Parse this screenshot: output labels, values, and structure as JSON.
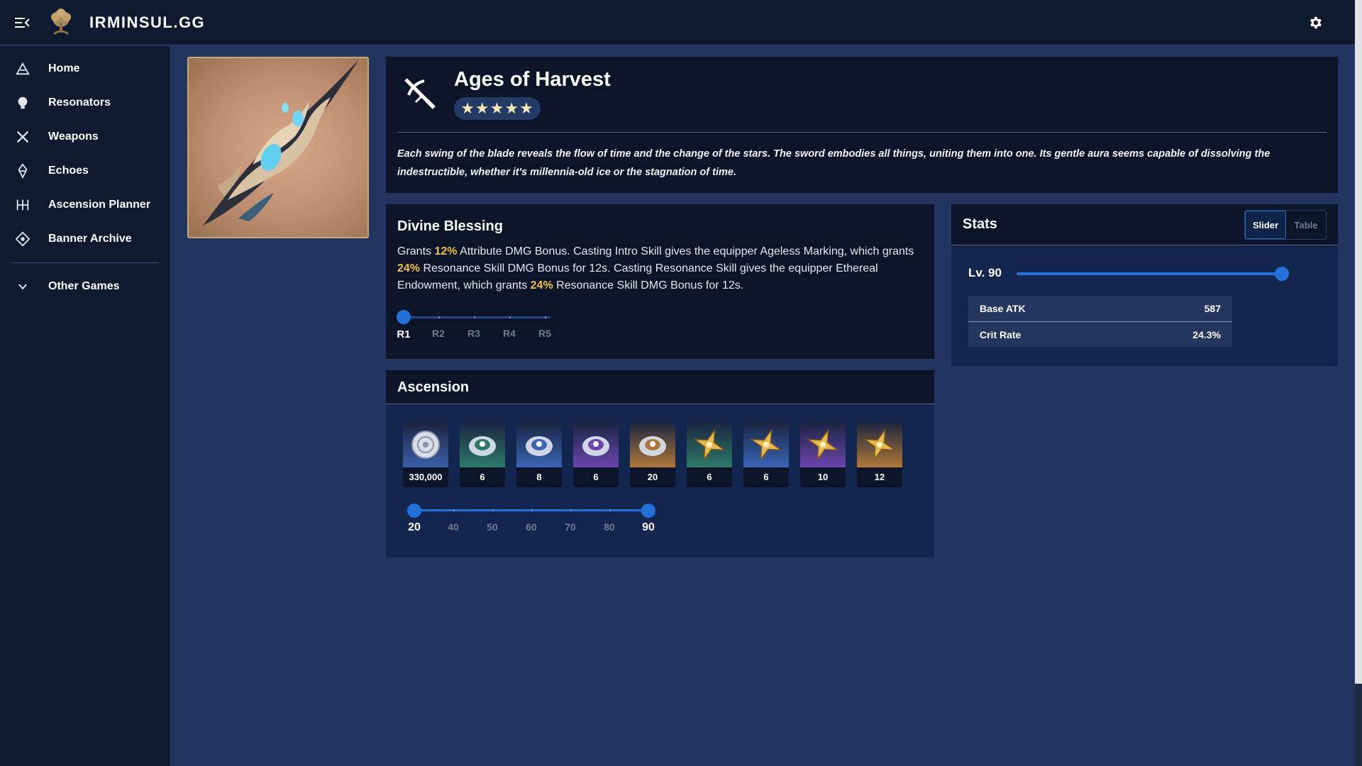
{
  "app": {
    "brand": "IRMINSUL.GG"
  },
  "sidebar": {
    "items": [
      {
        "label": "Home",
        "icon": "home-icon"
      },
      {
        "label": "Resonators",
        "icon": "resonators-icon"
      },
      {
        "label": "Weapons",
        "icon": "weapons-icon"
      },
      {
        "label": "Echoes",
        "icon": "echoes-icon"
      },
      {
        "label": "Ascension Planner",
        "icon": "ascension-planner-icon"
      },
      {
        "label": "Banner Archive",
        "icon": "banner-archive-icon"
      }
    ],
    "other_games": "Other Games"
  },
  "weapon": {
    "name": "Ages of Harvest",
    "rarity": "★★★★★",
    "rarity_stars": 5,
    "description": "Each swing of the blade reveals the flow of time and the change of the stars. The sword embodies all things, uniting them into one. Its gentle aura seems capable of dissolving the indestructible, whether it's millennia-old ice or the stagnation of time."
  },
  "passive": {
    "title": "Divine Blessing",
    "text": {
      "p1": "Grants ",
      "v1": "12%",
      "p2": " Attribute DMG Bonus. Casting Intro Skill gives the equipper Ageless Marking, which grants ",
      "v2": "24%",
      "p3": " Resonance Skill DMG Bonus for 12s. Casting Resonance Skill gives the equipper Ethereal Endowment, which grants ",
      "v3": "24%",
      "p4": " Resonance Skill DMG Bonus for 12s."
    },
    "refinements": [
      "R1",
      "R2",
      "R3",
      "R4",
      "R5"
    ],
    "selected_refinement": "R1"
  },
  "ascension": {
    "title": "Ascension",
    "materials": [
      {
        "count": "330,000",
        "color": "#3c5fa8"
      },
      {
        "count": "6",
        "color": "#2d7a6a"
      },
      {
        "count": "8",
        "color": "#3a64b8"
      },
      {
        "count": "6",
        "color": "#6c45b0"
      },
      {
        "count": "20",
        "color": "#b07838"
      },
      {
        "count": "6",
        "color": "#2d7a6a"
      },
      {
        "count": "6",
        "color": "#3a64b8"
      },
      {
        "count": "10",
        "color": "#6c45b0"
      },
      {
        "count": "12",
        "color": "#b07838"
      }
    ],
    "levels": [
      "20",
      "40",
      "50",
      "60",
      "70",
      "80",
      "90"
    ],
    "range_from": "20",
    "range_to": "90"
  },
  "stats": {
    "title": "Stats",
    "view_options": [
      "Slider",
      "Table"
    ],
    "selected_view": "Slider",
    "level_label": "Lv. 90",
    "level_fraction": 1.0,
    "rows": [
      {
        "name": "Base ATK",
        "value": "587"
      },
      {
        "name": "Crit Rate",
        "value": "24.3%"
      }
    ]
  },
  "colors": {
    "accent": "#2172d8",
    "highlight": "#f3c23a",
    "background": "#223560",
    "panel": "#0b1428"
  }
}
